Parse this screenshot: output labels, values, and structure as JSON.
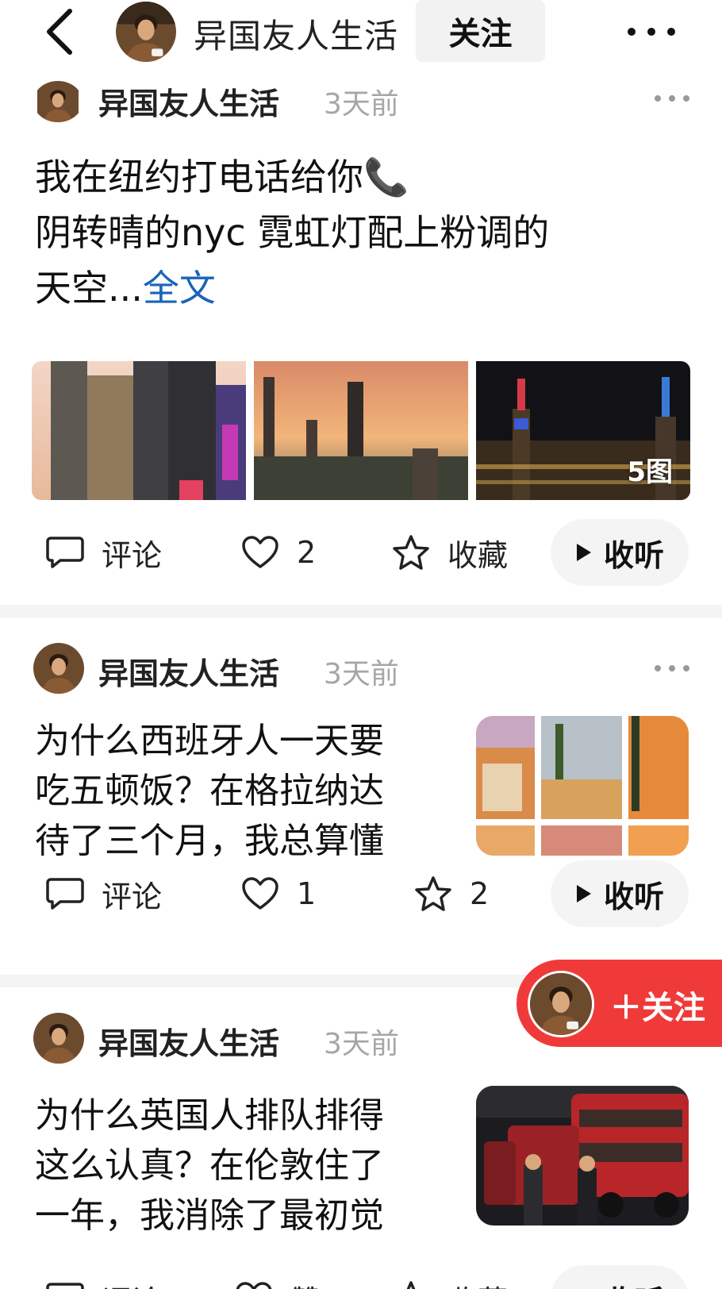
{
  "header": {
    "title": "异国友人生活",
    "follow_label": "关注"
  },
  "posts": [
    {
      "author": "异国友人生活",
      "time": "3天前",
      "text_line1": "我在纽约打电话给你📞",
      "text_line2": "阴转晴的nyc 霓虹灯配上粉调的",
      "text_line3": "天空...",
      "more_link": "全文",
      "image_count": "5图",
      "actions": {
        "comment": "评论",
        "like": "2",
        "favorite": "收藏",
        "listen": "收听"
      }
    },
    {
      "author": "异国友人生活",
      "time": "3天前",
      "text_lines": [
        "为什么西班牙人一天要",
        "吃五顿饭？在格拉纳达",
        "待了三个月，我总算懂"
      ],
      "actions": {
        "comment": "评论",
        "like": "1",
        "favorite": "2",
        "listen": "收听"
      }
    },
    {
      "author": "异国友人生活",
      "time": "3天前",
      "text_lines": [
        "为什么英国人排队排得",
        "这么认真？在伦敦住了",
        "一年，我消除了最初觉"
      ],
      "actions": {
        "comment": "评论",
        "like": "赞",
        "favorite": "收藏",
        "listen": "收听"
      }
    }
  ],
  "float_button": {
    "label": "＋关注"
  },
  "colors": {
    "accent_red": "#f03a3a",
    "link_blue": "#1a64b8",
    "muted": "#a6a6a6"
  },
  "icons": [
    "back-arrow-icon",
    "more-dots-icon",
    "comment-icon",
    "heart-icon",
    "star-icon",
    "play-icon"
  ]
}
